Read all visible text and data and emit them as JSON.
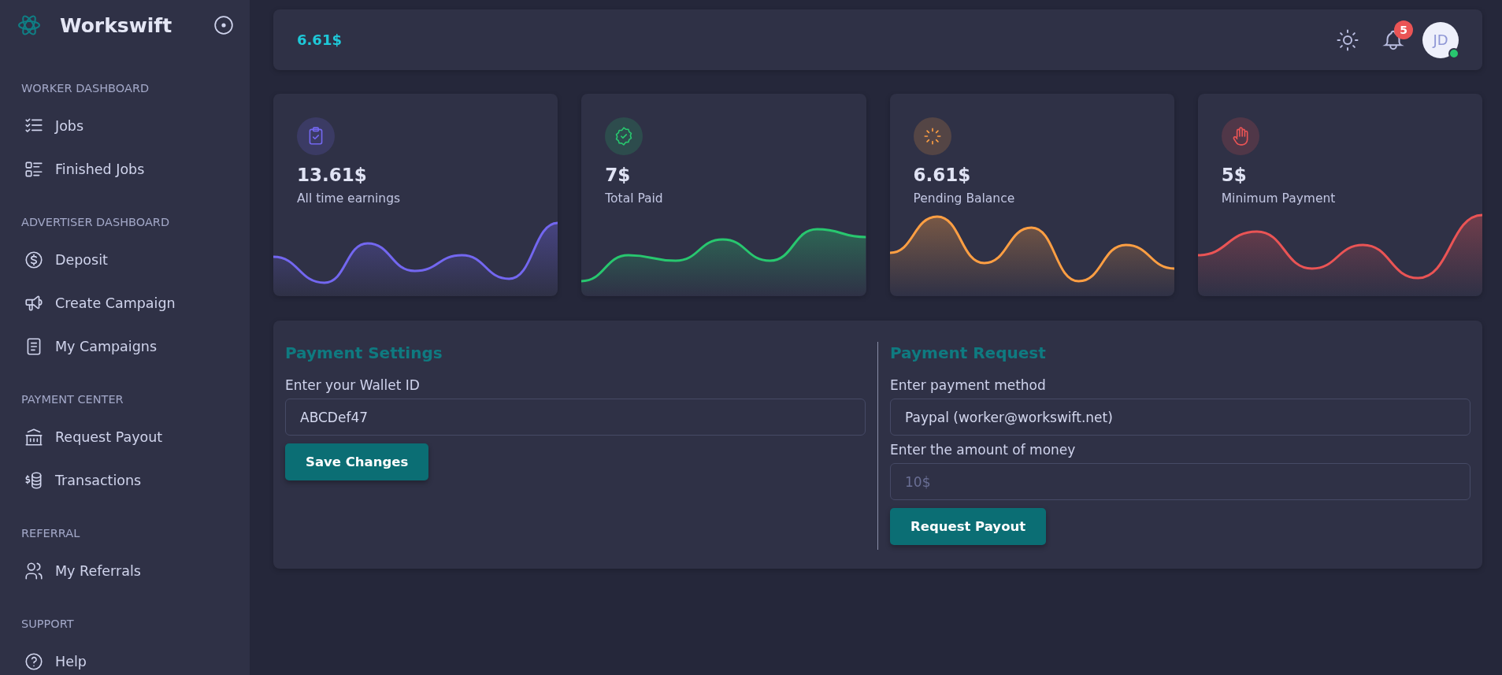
{
  "sidebar": {
    "brand": "Workswift",
    "sections": [
      {
        "title": "WORKER DASHBOARD",
        "items": [
          {
            "label": "Jobs"
          },
          {
            "label": "Finished Jobs"
          }
        ]
      },
      {
        "title": "ADVERTISER DASHBOARD",
        "items": [
          {
            "label": "Deposit"
          },
          {
            "label": "Create Campaign"
          },
          {
            "label": "My Campaigns"
          }
        ]
      },
      {
        "title": "PAYMENT CENTER",
        "items": [
          {
            "label": "Request Payout"
          },
          {
            "label": "Transactions"
          }
        ]
      },
      {
        "title": "REFERRAL",
        "items": [
          {
            "label": "My Referrals"
          }
        ]
      },
      {
        "title": "SUPPORT",
        "items": [
          {
            "label": "Help"
          }
        ]
      }
    ]
  },
  "header": {
    "balance": "6.61$",
    "notification_count": "5",
    "avatar_initials": "JD",
    "online": true
  },
  "stats": [
    {
      "value": "13.61$",
      "label": "All time earnings",
      "color": "#7367f0"
    },
    {
      "value": "7$",
      "label": "Total Paid",
      "color": "#28c76f"
    },
    {
      "value": "6.61$",
      "label": "Pending Balance",
      "color": "#ff9f43"
    },
    {
      "value": "5$",
      "label": "Minimum Payment",
      "color": "#ea5455"
    }
  ],
  "payment_settings": {
    "title": "Payment Settings",
    "wallet_label": "Enter your Wallet ID",
    "wallet_value": "ABCDef47",
    "button": "Save Changes"
  },
  "payment_request": {
    "title": "Payment Request",
    "method_label": "Enter payment method",
    "method_value": "Paypal (worker@workswift.net)",
    "amount_label": "Enter the amount of money",
    "amount_placeholder": "10$",
    "button": "Request Payout"
  }
}
